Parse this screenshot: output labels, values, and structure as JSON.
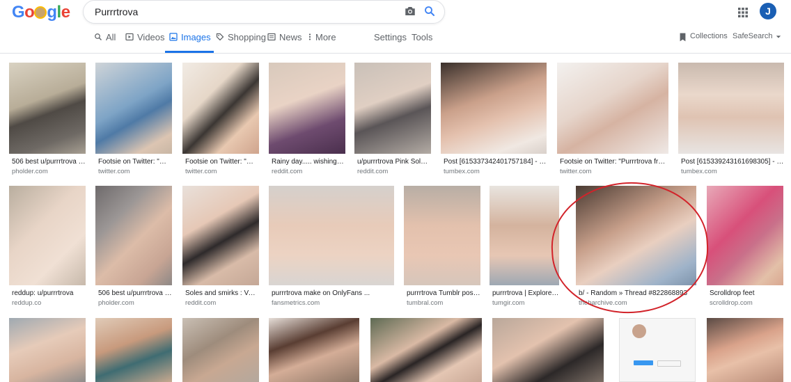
{
  "logo": {
    "text": "Google",
    "colors": [
      "#4285f4",
      "#ea4335",
      "#fbbc05",
      "#4285f4",
      "#34a853",
      "#ea4335"
    ]
  },
  "search": {
    "query": "Purrrtrova"
  },
  "account": {
    "initial": "J",
    "color": "#1a5fb4"
  },
  "tabs": [
    {
      "label": "All",
      "icon": "search-icon"
    },
    {
      "label": "Videos",
      "icon": "video-icon"
    },
    {
      "label": "Images",
      "icon": "image-icon",
      "active": true
    },
    {
      "label": "Shopping",
      "icon": "tag-icon"
    },
    {
      "label": "News",
      "icon": "news-icon"
    },
    {
      "label": "More",
      "icon": "more-vert-icon"
    }
  ],
  "tools": {
    "settings": "Settings",
    "tools": "Tools",
    "collections": "Collections",
    "safesearch": "SafeSearch"
  },
  "results": [
    {
      "caption": "506 best u/purrrtrova i...",
      "source": "pholder.com"
    },
    {
      "caption": "Footsie on Twitter: \"Mi...",
      "source": "twitter.com"
    },
    {
      "caption": "Footsie on Twitter: \"Mi...",
      "source": "twitter.com"
    },
    {
      "caption": "Rainy day..... wishing I ...",
      "source": "reddit.com"
    },
    {
      "caption": "u/purrrtrova Pink Soles...",
      "source": "reddit.com"
    },
    {
      "caption": "Post [615337342401757184] - t0...",
      "source": "tumbex.com"
    },
    {
      "caption": "Footsie on Twitter: \"Purrrtrova from...",
      "source": "twitter.com"
    },
    {
      "caption": "Post [615339243161698305] - t0...",
      "source": "tumbex.com"
    },
    {
      "caption": "reddup: u/purrrtrova",
      "source": "reddup.co"
    },
    {
      "caption": "506 best u/purrrtrova i...",
      "source": "pholder.com"
    },
    {
      "caption": "Soles and smirks : Veri...",
      "source": "reddit.com"
    },
    {
      "caption": "purrrtrova make on OnlyFans ...",
      "source": "fansmetrics.com"
    },
    {
      "caption": "purrrtrova Tumblr post...",
      "source": "tumbral.com"
    },
    {
      "caption": "purrrtrova | Explore Tu...",
      "source": "tumgir.com"
    },
    {
      "caption": "b/ - Random » Thread #822868893",
      "source": "thebarchive.com"
    },
    {
      "caption": "Scrolldrop feet",
      "source": "scrolldrop.com"
    }
  ]
}
